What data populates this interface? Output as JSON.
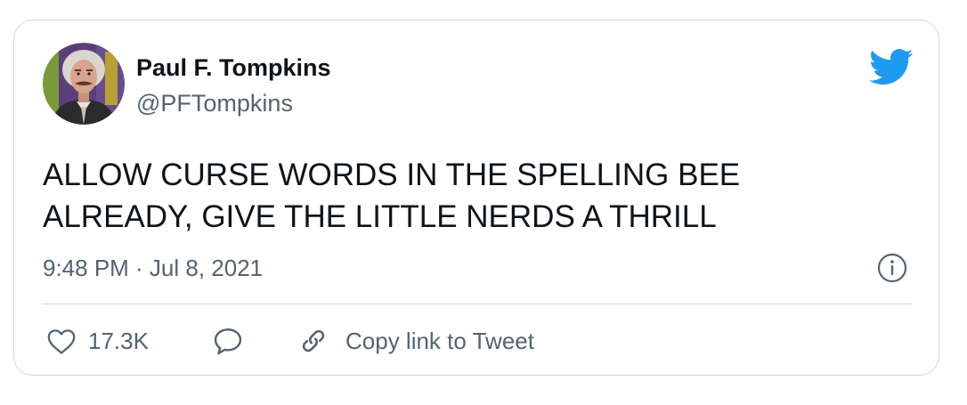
{
  "tweet": {
    "author": {
      "display_name": "Paul F. Tompkins",
      "handle": "@PFTompkins"
    },
    "text_lines": [
      "ALLOW CURSE WORDS IN THE SPELLING BEE",
      "ALREADY, GIVE THE LITTLE NERDS A THRILL"
    ],
    "timestamp": "9:48 PM · Jul 8, 2021",
    "actions": {
      "like_count": "17.3K",
      "copy_link_label": "Copy link to Tweet"
    }
  },
  "icons": {
    "brand": "twitter-bird-icon",
    "info": "info-icon",
    "like": "heart-icon",
    "reply": "speech-bubble-icon",
    "copy_link": "link-icon"
  },
  "colors": {
    "brand_blue": "#1d9bf0",
    "text_primary": "#0f1419",
    "text_secondary": "#536471",
    "border": "#cfd9de"
  }
}
